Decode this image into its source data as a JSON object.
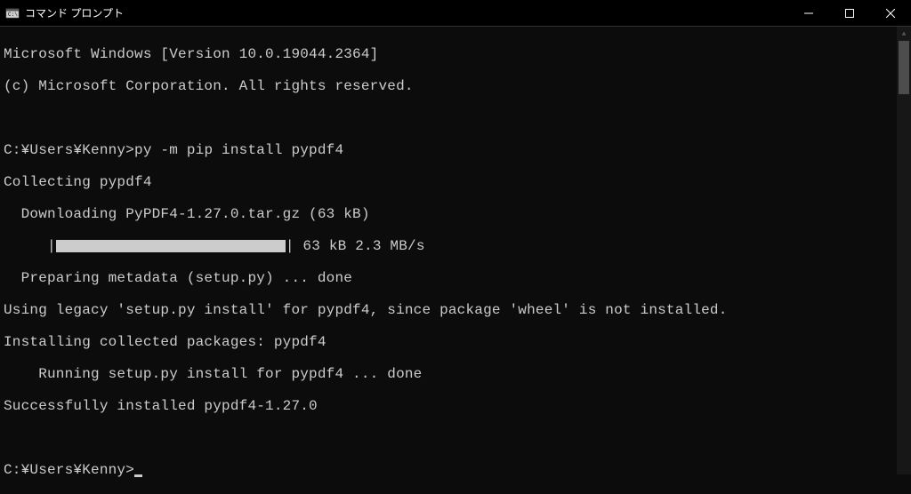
{
  "titlebar": {
    "title": "コマンド プロンプト"
  },
  "terminal": {
    "line1": "Microsoft Windows [Version 10.0.19044.2364]",
    "line2": "(c) Microsoft Corporation. All rights reserved.",
    "prompt1": "C:¥Users¥Kenny>",
    "command1": "py -m pip install pypdf4",
    "line4": "Collecting pypdf4",
    "line5": "  Downloading PyPDF4-1.27.0.tar.gz (63 kB)",
    "progress_prefix": "     |",
    "progress_suffix": "| 63 kB 2.3 MB/s",
    "line7": "  Preparing metadata (setup.py) ... done",
    "line8": "Using legacy 'setup.py install' for pypdf4, since package 'wheel' is not installed.",
    "line9": "Installing collected packages: pypdf4",
    "line10": "    Running setup.py install for pypdf4 ... done",
    "line11": "Successfully installed pypdf4-1.27.0",
    "prompt2": "C:¥Users¥Kenny>"
  }
}
